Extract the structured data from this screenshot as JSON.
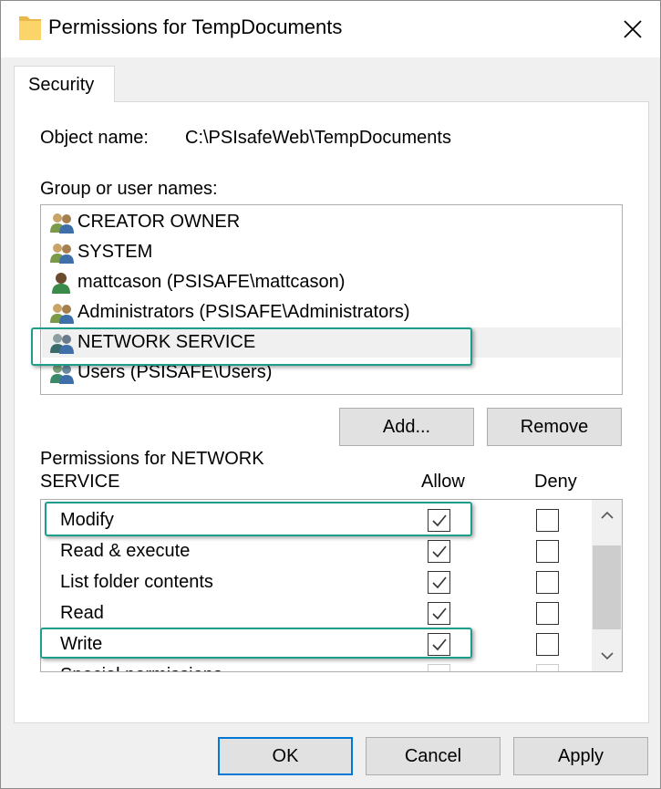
{
  "window": {
    "title": "Permissions for TempDocuments"
  },
  "tab": {
    "label": "Security"
  },
  "object": {
    "label": "Object name:",
    "value": "C:\\PSIsafeWeb\\TempDocuments"
  },
  "groups": {
    "label": "Group or user names:",
    "items": [
      {
        "name": "CREATOR OWNER",
        "icon": "group-icon"
      },
      {
        "name": "SYSTEM",
        "icon": "group-icon"
      },
      {
        "name": "mattcason (PSISAFE\\mattcason)",
        "icon": "user-icon"
      },
      {
        "name": "Administrators (PSISAFE\\Administrators)",
        "icon": "group-icon"
      },
      {
        "name": "NETWORK SERVICE",
        "icon": "group-icon",
        "selected": true
      },
      {
        "name": "Users (PSISAFE\\Users)",
        "icon": "group-icon"
      }
    ],
    "add_label": "Add...",
    "remove_label": "Remove"
  },
  "permissions": {
    "header_line1": "Permissions for NETWORK",
    "header_line2": "SERVICE",
    "allow_label": "Allow",
    "deny_label": "Deny",
    "rows": [
      {
        "name": "Modify",
        "allow": true,
        "deny": false
      },
      {
        "name": "Read & execute",
        "allow": true,
        "deny": false
      },
      {
        "name": "List folder contents",
        "allow": true,
        "deny": false
      },
      {
        "name": "Read",
        "allow": true,
        "deny": false
      },
      {
        "name": "Write",
        "allow": true,
        "deny": false
      },
      {
        "name": "Special permissions",
        "allow": false,
        "deny": false
      }
    ]
  },
  "footer": {
    "ok_label": "OK",
    "cancel_label": "Cancel",
    "apply_label": "Apply"
  },
  "colors": {
    "highlight": "#1e9e8a",
    "default_button_border": "#0078d7"
  }
}
